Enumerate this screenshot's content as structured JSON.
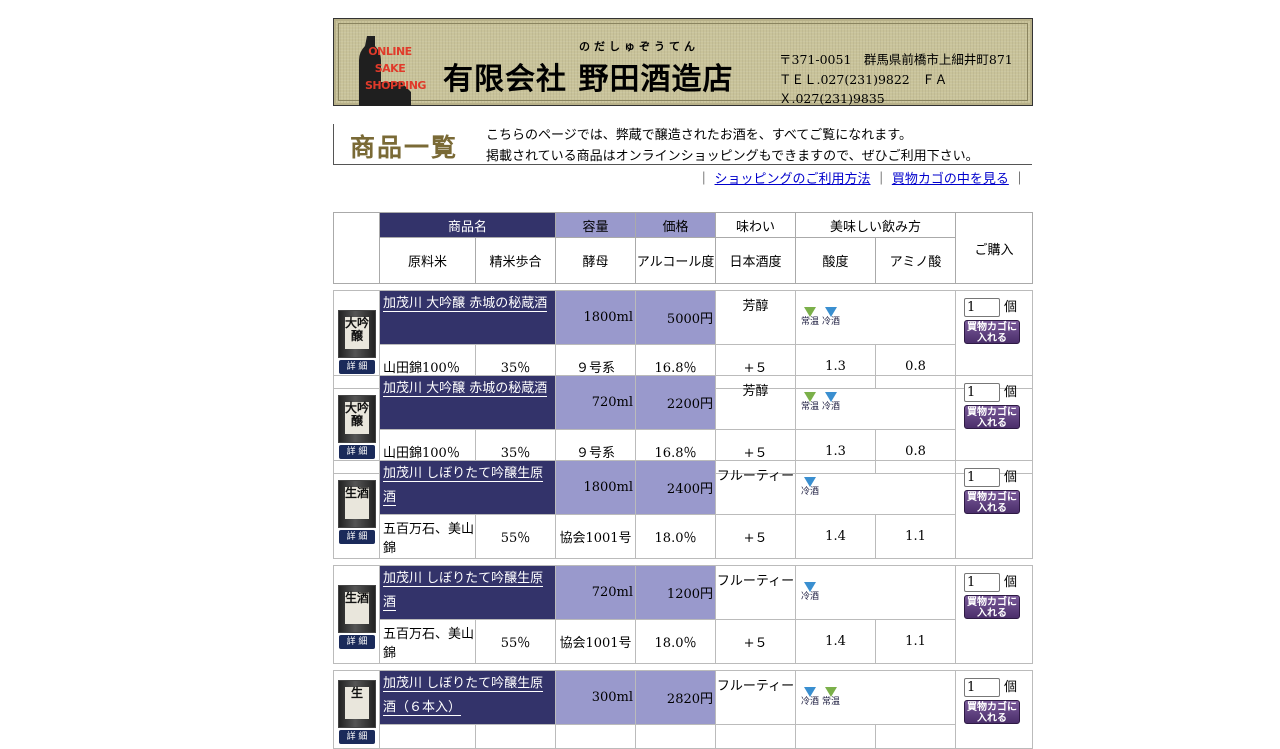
{
  "header": {
    "logo_lines": [
      "ONLINE",
      "SAKE",
      "SHOPPING"
    ],
    "company_ruby": "のだしゅぞうてん",
    "company_name": "有限会社 野田酒造店",
    "address": "〒371-0051　群馬県前橋市上細井町871",
    "contact": "ＴＥＬ.027(231)9822　ＦＡＸ.027(231)9835"
  },
  "intro": {
    "title": "商品一覧",
    "line1": "こちらのページでは、弊蔵で醸造されたお酒を、すべてご覧になれます。",
    "line2": "掲載されている商品はオンラインショッピングもできますので、ぜひご利用下さい。"
  },
  "links": {
    "usage": "ショッピングのご利用方法",
    "cart": "買物カゴの中を見る",
    "sep": "｜"
  },
  "table_header": {
    "name": "商品名",
    "volume": "容量",
    "price": "価格",
    "taste": "味わい",
    "howto": "美味しい飲み方",
    "purchase": "ご購入",
    "rice": "原料米",
    "polish": "精米歩合",
    "yeast": "酵母",
    "alcohol": "アルコール度",
    "smv": "日本酒度",
    "acidity": "酸度",
    "amino": "アミノ酸"
  },
  "labels": {
    "detail": "詳 細",
    "cart_button": "買物カゴに入れる",
    "qty_unit": "個",
    "temp_room": "常温",
    "temp_cold": "冷酒"
  },
  "products": [
    {
      "name": "加茂川 大吟醸 赤城の秘蔵酒",
      "volume": "1800ml",
      "price": "5000円",
      "taste": "芳醇",
      "temps": [
        "常温",
        "冷酒"
      ],
      "rice": "山田錦100％",
      "polish": "35％",
      "yeast": "９号系",
      "alcohol": "16.8％",
      "smv": "+５",
      "acidity": "1.3",
      "amino": "0.8",
      "qty": "1",
      "bottle_label": "大吟醸"
    },
    {
      "name": "加茂川 大吟醸 赤城の秘蔵酒",
      "volume": "720ml",
      "price": "2200円",
      "taste": "芳醇",
      "temps": [
        "常温",
        "冷酒"
      ],
      "rice": "山田錦100％",
      "polish": "35％",
      "yeast": "９号系",
      "alcohol": "16.8％",
      "smv": "+５",
      "acidity": "1.3",
      "amino": "0.8",
      "qty": "1",
      "bottle_label": "大吟醸"
    },
    {
      "name": "加茂川 しぼりたて吟醸生原酒",
      "volume": "1800ml",
      "price": "2400円",
      "taste": "フルーティー",
      "temps": [
        "冷酒"
      ],
      "rice": "五百万石、美山錦",
      "polish": "55％",
      "yeast": "協会1001号",
      "alcohol": "18.0％",
      "smv": "+５",
      "acidity": "1.4",
      "amino": "1.1",
      "qty": "1",
      "bottle_label": "生酒"
    },
    {
      "name": "加茂川 しぼりたて吟醸生原酒",
      "volume": "720ml",
      "price": "1200円",
      "taste": "フルーティー",
      "temps": [
        "冷酒"
      ],
      "rice": "五百万石、美山錦",
      "polish": "55％",
      "yeast": "協会1001号",
      "alcohol": "18.0％",
      "smv": "+５",
      "acidity": "1.4",
      "amino": "1.1",
      "qty": "1",
      "bottle_label": "生酒"
    },
    {
      "name": "加茂川 しぼりたて吟醸生原酒（６本入）",
      "volume": "300ml",
      "price": "2820円",
      "taste": "フルーティー",
      "temps": [
        "冷酒",
        "常温"
      ],
      "qty": "1",
      "bottle_label": "生"
    }
  ]
}
